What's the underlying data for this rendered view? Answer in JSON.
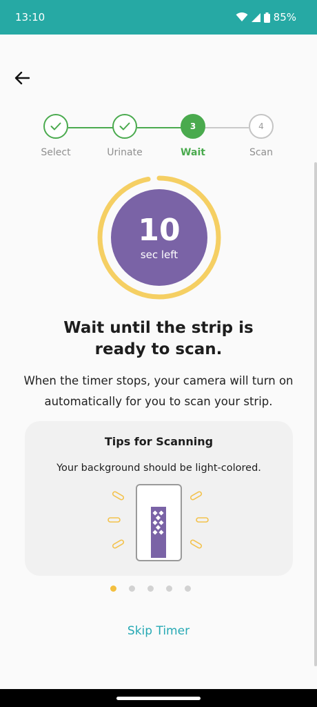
{
  "status_bar": {
    "time": "13:10",
    "battery": "85%",
    "icons": [
      "wifi-icon",
      "cell-signal-icon",
      "battery-icon"
    ]
  },
  "navigation": {
    "back_icon": "arrow-left-icon"
  },
  "stepper": {
    "steps": [
      {
        "label": "Select",
        "state": "done",
        "marker": ""
      },
      {
        "label": "Urinate",
        "state": "done",
        "marker": ""
      },
      {
        "label": "Wait",
        "state": "active",
        "marker": "3"
      },
      {
        "label": "Scan",
        "state": "pending",
        "marker": "4"
      }
    ],
    "colors": {
      "done": "#4aaa4e",
      "pending": "#c4c4c4"
    }
  },
  "timer": {
    "value": "10",
    "unit": "sec left",
    "progress_fraction": 0.97,
    "colors": {
      "ring": "#f5cf63",
      "fill": "#7a63a6"
    }
  },
  "content": {
    "heading_line1": "Wait until the strip is",
    "heading_line2": "ready to scan.",
    "body_line1": "When the timer stops, your camera will turn on",
    "body_line2": "automatically for you to scan your strip."
  },
  "tips": {
    "title": "Tips for Scanning",
    "text": "Your background should be light-colored.",
    "illustration": "test-strip-illustration"
  },
  "pagination": {
    "count": 5,
    "active_index": 0,
    "active_color": "#f3bf3f"
  },
  "actions": {
    "skip_label": "Skip Timer",
    "accent": "#26a9b4"
  },
  "theme": {
    "status_bar": "#26a9a4"
  }
}
